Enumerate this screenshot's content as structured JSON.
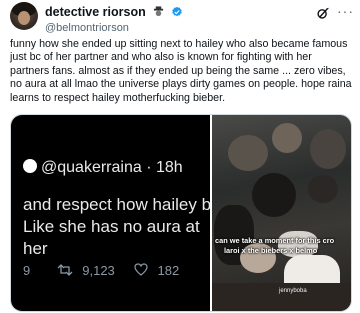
{
  "author": {
    "display_name": "detective riorson",
    "handle": "@belmontriorson",
    "name_emoji": "detective-emoji"
  },
  "tweet": {
    "text": "funny how she ended up sitting next to hailey who also became famous just bc of her partner and who also is known for fighting with her partners fans. almost as if they ended up being the same ... zero vibes, no aura at all lmao the universe plays dirty games on people. hope raina learns to respect hailey motherfucking bieber."
  },
  "media_left": {
    "handle": "@quakerraina",
    "time": "· 18h",
    "line1": "and respect how hailey b",
    "line2": "Like she has no aura at",
    "line3": "her",
    "reply_count": "9",
    "retweet_count": "9,123",
    "like_count": "182"
  },
  "media_right": {
    "caption1": "can we take a moment for this cro",
    "caption2": "laroi x the biebers x belmo",
    "watermark": "jennyboba"
  },
  "colors": {
    "text": "#0f1419",
    "secondary": "#536471",
    "verified": "#1d9bf0"
  }
}
